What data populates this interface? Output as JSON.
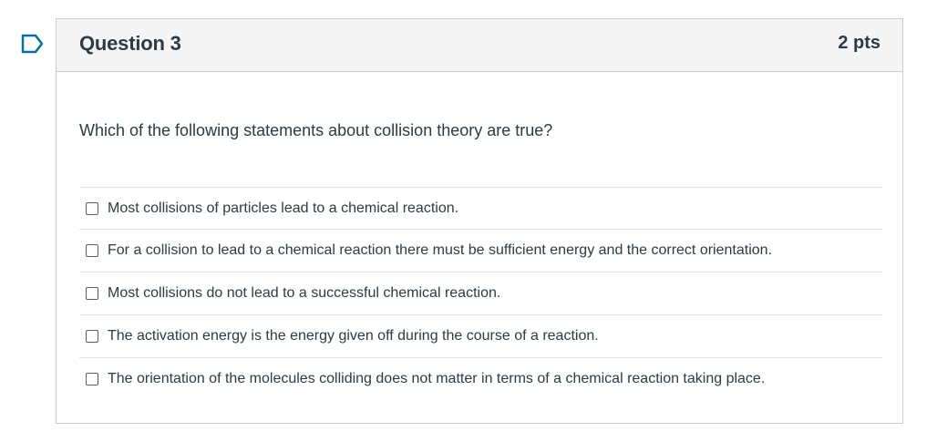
{
  "question": {
    "title": "Question 3",
    "points": "2 pts",
    "flag_icon": "flag-outline-icon",
    "text": "Which of the following statements about collision theory are true?",
    "answers": [
      {
        "label": "Most collisions of particles lead to a chemical reaction.",
        "checked": false
      },
      {
        "label": "For a collision to lead to a chemical reaction there must be sufficient energy and the correct orientation.",
        "checked": false
      },
      {
        "label": "Most collisions do not lead to a successful chemical reaction.",
        "checked": false
      },
      {
        "label": "The activation energy is the energy given off during the course of a reaction.",
        "checked": false
      },
      {
        "label": "The orientation of the molecules colliding does not matter in terms of a chemical reaction taking place.",
        "checked": false
      }
    ]
  },
  "colors": {
    "flag_outline": "#0770a3",
    "text": "#2d3b45",
    "header_bg": "#f5f5f5",
    "border": "#c7cdd1"
  }
}
